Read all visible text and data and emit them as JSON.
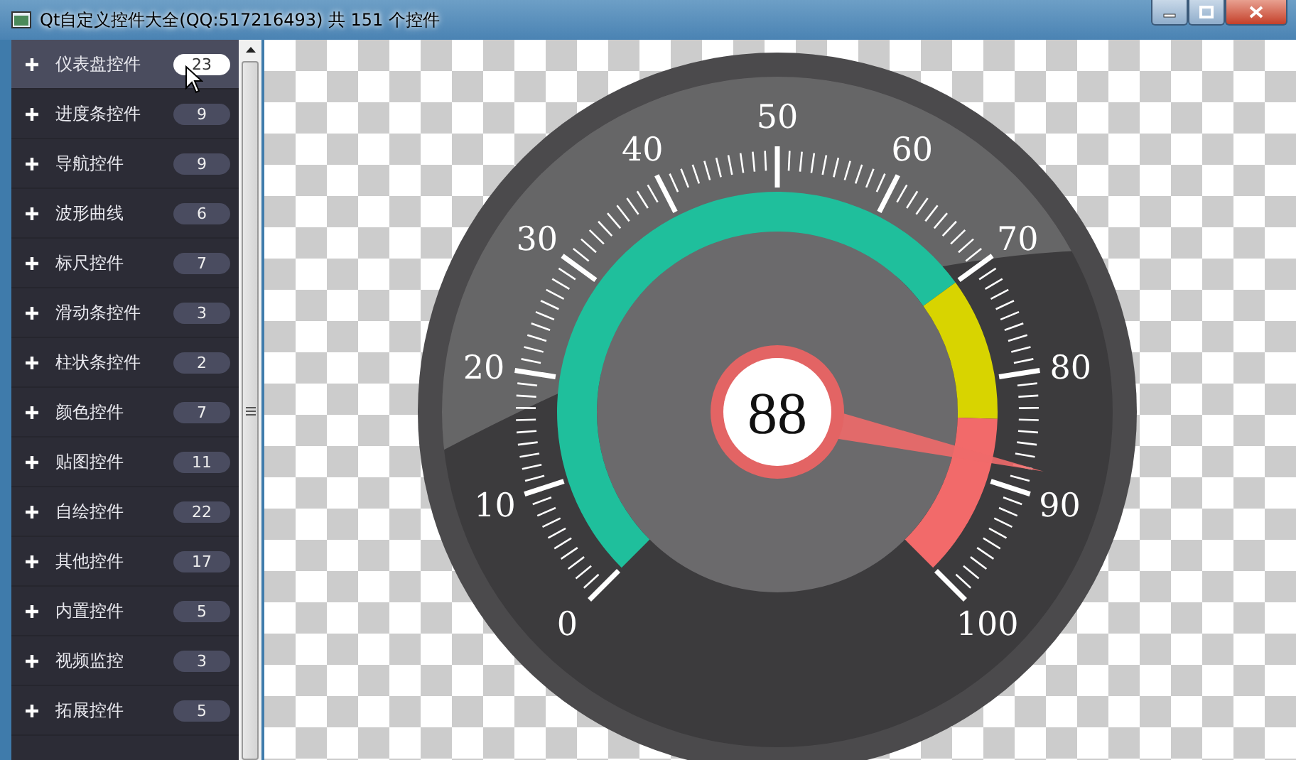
{
  "window": {
    "title": "Qt自定义控件大全(QQ:517216493) 共 151 个控件"
  },
  "sidebar": {
    "items": [
      {
        "label": "仪表盘控件",
        "count": "23",
        "selected": true
      },
      {
        "label": "进度条控件",
        "count": "9",
        "selected": false
      },
      {
        "label": "导航控件",
        "count": "9",
        "selected": false
      },
      {
        "label": "波形曲线",
        "count": "6",
        "selected": false
      },
      {
        "label": "标尺控件",
        "count": "7",
        "selected": false
      },
      {
        "label": "滑动条控件",
        "count": "3",
        "selected": false
      },
      {
        "label": "柱状条控件",
        "count": "2",
        "selected": false
      },
      {
        "label": "颜色控件",
        "count": "7",
        "selected": false
      },
      {
        "label": "贴图控件",
        "count": "11",
        "selected": false
      },
      {
        "label": "自绘控件",
        "count": "22",
        "selected": false
      },
      {
        "label": "其他控件",
        "count": "17",
        "selected": false
      },
      {
        "label": "内置控件",
        "count": "5",
        "selected": false
      },
      {
        "label": "视频监控",
        "count": "3",
        "selected": false
      },
      {
        "label": "拓展控件",
        "count": "5",
        "selected": false
      }
    ]
  },
  "gauge": {
    "value": "88",
    "level": 0.88,
    "scale_labels": [
      "0",
      "10",
      "20",
      "30",
      "40",
      "50",
      "60",
      "70",
      "80",
      "90",
      "100"
    ]
  }
}
